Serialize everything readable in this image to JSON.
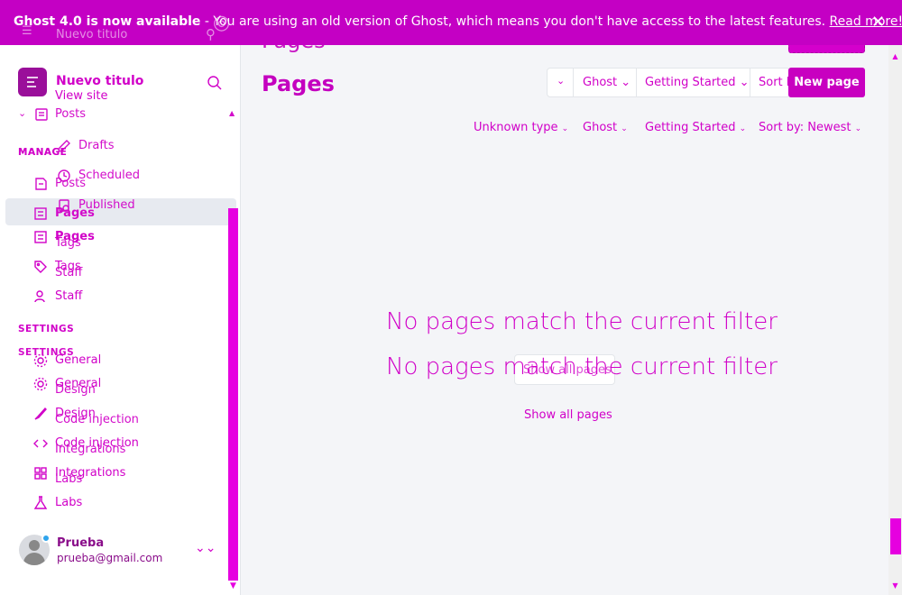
{
  "banner": {
    "bold_text": "Ghost 4.0 is now available",
    "text": " - You are using an old version of Ghost, which means you don't have access to the latest features. ",
    "link": "Read more!",
    "close_icon": "close-icon",
    "ghost_site": "Nuevo titulo"
  },
  "sidebar": {
    "site_title": "Nuevo titulo",
    "view_site": "View site",
    "posts_label": "Posts",
    "subitems": [
      "Drafts",
      "Scheduled",
      "Published"
    ],
    "manage_header": "MANAGE",
    "manage_items": [
      "Posts",
      "Pages",
      "Tags",
      "Staff"
    ],
    "settings_header": "SETTINGS",
    "settings_items": [
      "General",
      "Design",
      "Code injection",
      "Integrations",
      "Labs"
    ],
    "user": {
      "name": "Prueba",
      "email": "prueba@gmail.com"
    }
  },
  "main": {
    "title": "Pages",
    "filters": {
      "type": "Unknown type",
      "author": "Ghost",
      "tag": "Getting Started",
      "sort": "Sort by: Newest",
      "sort_short": "Sort by"
    },
    "new_button": "New page",
    "empty_message": "No pages match the current filter",
    "show_all": "Show all pages"
  },
  "colors": {
    "accent": "#d100c8",
    "banner": "#c400c4",
    "brand_box": "#9a0f9a"
  }
}
